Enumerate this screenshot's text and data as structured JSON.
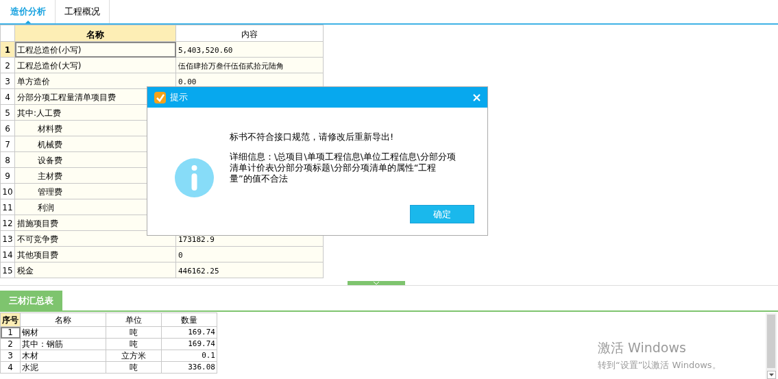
{
  "tabs": [
    {
      "label": "造价分析",
      "selected": true
    },
    {
      "label": "工程概况",
      "selected": false
    }
  ],
  "summary_table": {
    "columns": [
      "名称",
      "内容"
    ],
    "rows": [
      {
        "number": "1",
        "name": "工程总造价(小写)",
        "content": "5,403,520.60",
        "selected": true
      },
      {
        "number": "2",
        "name": "工程总造价(大写)",
        "content": "伍佰肆拾万叁仟伍佰贰拾元陆角",
        "selected": false
      },
      {
        "number": "3",
        "name": "单方造价",
        "content": "0.00",
        "selected": false
      },
      {
        "number": "4",
        "name": "分部分项工程量清单项目费",
        "selected": false
      },
      {
        "number": "5",
        "name": "其中:人工费",
        "selected": false,
        "children": [
          {
            "number": "6",
            "name": "材料费",
            "selected": false
          },
          {
            "number": "7",
            "name": "机械费",
            "selected": false
          },
          {
            "number": "8",
            "name": "设备费",
            "selected": false
          },
          {
            "number": "9",
            "name": "主材费",
            "selected": false
          },
          {
            "number": "10",
            "name": "管理费",
            "selected": false
          },
          {
            "number": "11",
            "name": "利润",
            "selected": false
          }
        ]
      },
      {
        "number": "12",
        "name": "措施项目费",
        "selected": false
      },
      {
        "number": "13",
        "name": "不可竞争费",
        "content": "173182.9",
        "selected": false
      },
      {
        "number": "14",
        "name": "其他项目费",
        "content": "0",
        "selected": false
      },
      {
        "number": "15",
        "name": "税金",
        "content": "446162.25",
        "selected": false
      }
    ]
  },
  "bottom_tab": {
    "label": "三材汇总表"
  },
  "materials_table": {
    "columns": [
      "序号",
      "名称",
      "单位",
      "数量"
    ],
    "rows": [
      {
        "number": "1",
        "name": "钢材",
        "unit": "吨",
        "quantity": "169.74",
        "selected": true
      },
      {
        "number": "2",
        "name": "其中：钢筋",
        "unit": "吨",
        "quantity": "169.74",
        "selected": false
      },
      {
        "number": "3",
        "name": "木材",
        "unit": "立方米",
        "quantity": "0.1",
        "selected": false
      },
      {
        "number": "4",
        "name": "水泥",
        "unit": "吨",
        "quantity": "336.08",
        "selected": false
      }
    ]
  },
  "dialog": {
    "title": "提示",
    "message": "标书不符合接口规范，请修改后重新导出!",
    "details": "详细信息：\\总项目\\单项工程信息\\单位工程信息\\分部分项清单计价表\\分部分项标题\\分部分项清单的属性“工程量”的值不合法",
    "button": "确定"
  },
  "activation_notice": {
    "title": "激活 Windows",
    "text": "转到“设置”以激活 Windows。"
  }
}
